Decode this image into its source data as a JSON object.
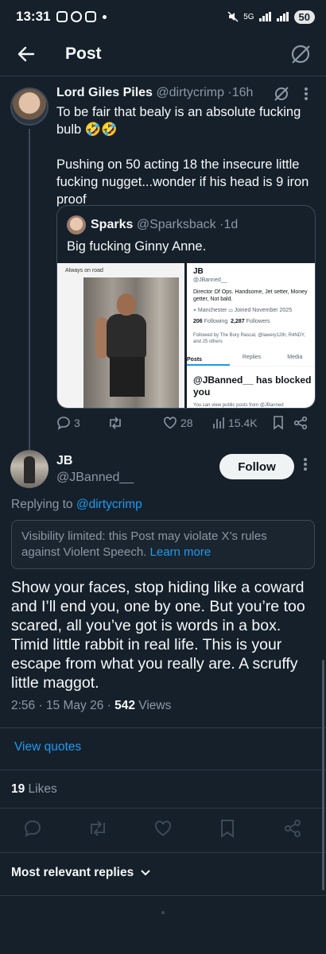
{
  "status_bar": {
    "time": "13:31",
    "network": "5G",
    "battery": "50"
  },
  "header": {
    "title": "Post"
  },
  "tweet": {
    "author_name": "Lord Giles Piles",
    "handle": "@dirtycrimp",
    "time": "16h",
    "text": "To be fair that bealy is an absolute fucking bulb 🤣🤣\n\nPushing on 50 acting 18 the insecure little fucking nugget...wonder if his head is 9 iron proof",
    "quote": {
      "author_name": "Sparks",
      "handle": "@Sparksback",
      "time": "1d",
      "text": "Big fucking Ginny Anne.",
      "image_left_caption": "Always on road",
      "profile": {
        "name": "JB",
        "handle": "@JBanned__",
        "bio": "Director Of Ops. Handsome, Jet setter, Money getter, Not bald.",
        "location": "Manchester",
        "joined": "Joined November 2025",
        "following": "206",
        "following_label": "Following",
        "followers": "2,287",
        "followers_label": "Followers",
        "followed_by": "Followed by The Bury Rascal, @lawery12th, R4NDY, and 25 others",
        "tabs": [
          "Posts",
          "Replies",
          "Media"
        ],
        "blocked_text": "@JBanned__ has blocked you",
        "blocked_sub": "You can view public posts from @JBanned"
      }
    },
    "stats": {
      "replies": "3",
      "likes": "28",
      "views": "15.4K"
    }
  },
  "reply": {
    "author_name": "JB",
    "handle": "@JBanned__",
    "follow_label": "Follow",
    "replying_prefix": "Replying to",
    "replying_to": "@dirtycrimp",
    "visibility_text": "Visibility limited: this Post may violate X’s rules against Violent Speech.",
    "learn_more": "Learn more",
    "text": "Show your faces, stop hiding like a coward and I’ll end you, one by one. But you’re too scared, all you’ve got is words in a box. Timid little rabbit in real life. This is your escape from what you really are. A scruffy little maggot.",
    "timestamp": "2:56 · 15 May 26 · ",
    "views_count": "542",
    "views_label": " Views",
    "view_quotes": "View quotes",
    "likes_count": "19",
    "likes_label": " Likes"
  },
  "replies_filter": {
    "label": "Most relevant replies"
  },
  "colors": {
    "background": "#15202b",
    "accent": "#1d9bf0",
    "muted": "#8b98a5",
    "text": "#f7f9f9"
  }
}
